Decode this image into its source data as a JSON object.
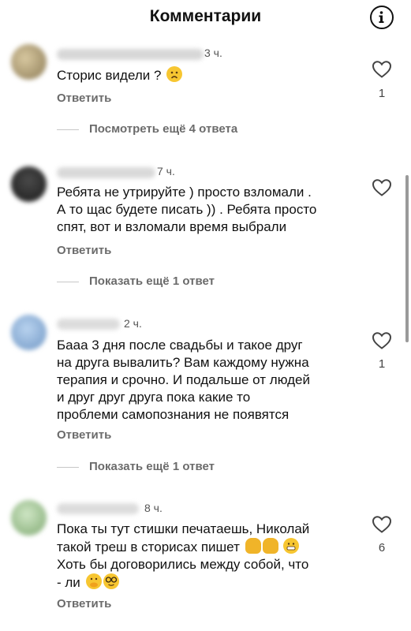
{
  "header": {
    "title": "Комментарии",
    "info_icon": "info-icon"
  },
  "comments": [
    {
      "time": "3 ч.",
      "text": "Сторис видели ?",
      "emoji": [
        "worried-face"
      ],
      "reply_label": "Ответить",
      "likes": "1",
      "replies_label": "Посмотреть ещё 4 ответа"
    },
    {
      "time": "7 ч.",
      "text_lines": [
        "Ребята не утрируйте ) просто взломали .",
        "А то щас будете писать )) . Ребята просто",
        "спят, вот и взломали время выбрали"
      ],
      "reply_label": "Ответить",
      "likes": "",
      "replies_label": "Показать ещё 1 ответ"
    },
    {
      "time": "2 ч.",
      "text_lines": [
        "Бааа 3 дня после свадьбы и такое друг",
        "на друга вывалить? Вам каждому нужна",
        "терапия и срочно. И подальше от людей",
        "и друг друг друга пока какие то",
        "проблеми самопознания не появятся"
      ],
      "reply_label": "Ответить",
      "likes": "1",
      "replies_label": "Показать ещё 1 ответ"
    },
    {
      "time": "8 ч.",
      "text_lines": [
        "Пока ты тут стишки печатаешь, Николай",
        "такой треш в сторисах пишет",
        "Хоть бы договорились между собой, что",
        "- ли"
      ],
      "emoji_line2": [
        "facepalm-woman",
        "facepalm-woman",
        "grimacing-face"
      ],
      "emoji_line4": [
        "face-with-hand-over-mouth",
        "nerd-face"
      ],
      "reply_label": "Ответить",
      "likes": "6"
    }
  ],
  "colors": {
    "text": "#111111",
    "secondary": "#6b6b6b",
    "divider": "#c7c7c7",
    "emoji_yellow": "#f7c631"
  }
}
